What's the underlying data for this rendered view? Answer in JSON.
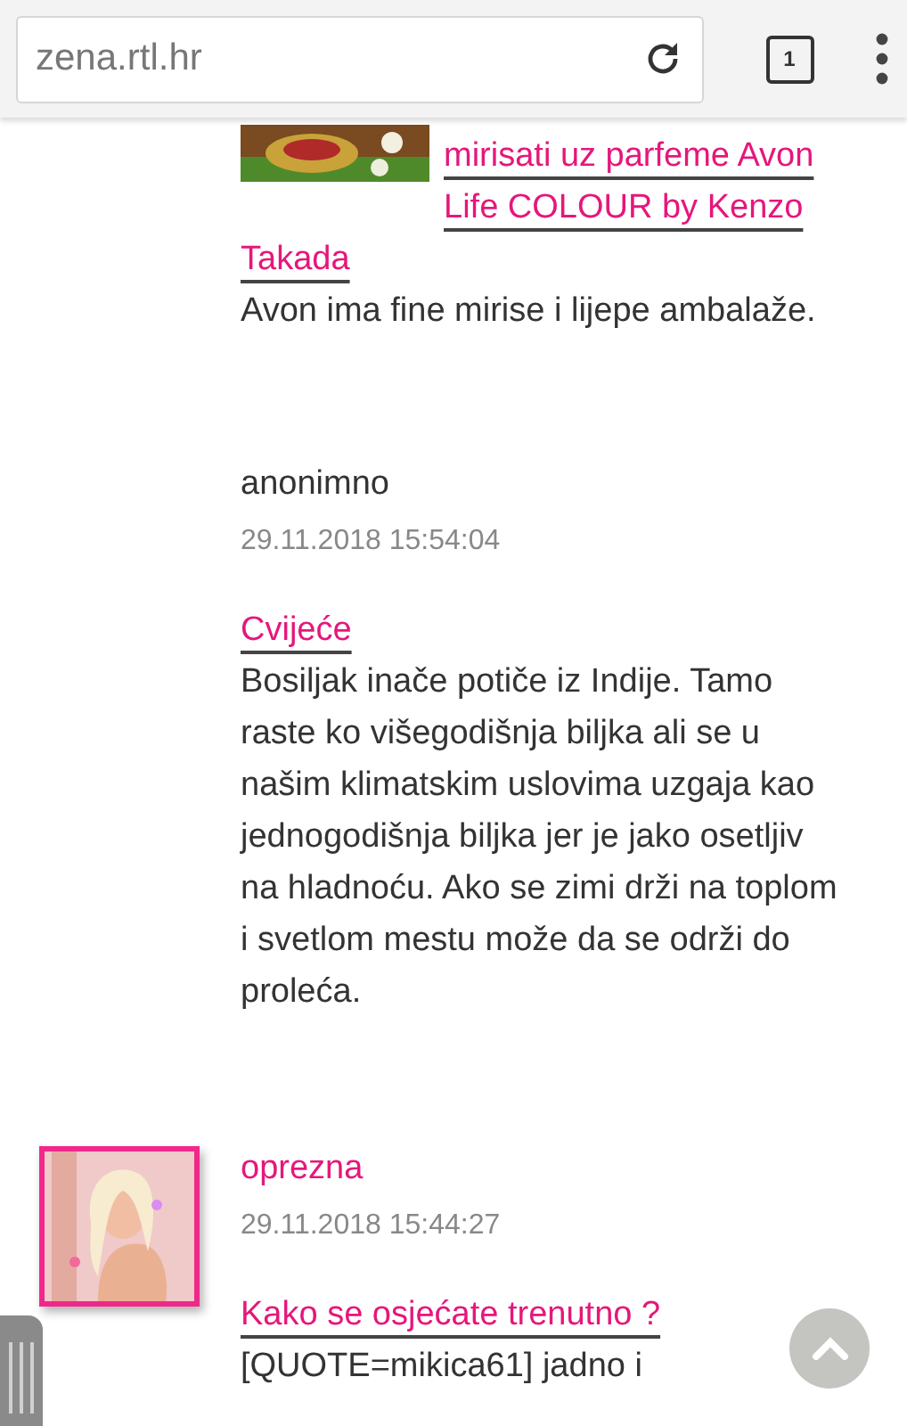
{
  "browser": {
    "url": "zena.rtl.hr",
    "tab_count": "1"
  },
  "posts": [
    {
      "kind": "article",
      "title_lines": [
        "mirisati uz parfeme Avon",
        "Life COLOUR by Kenzo",
        "Takada"
      ],
      "body": "Avon ima fine mirise i lijepe ambalaže."
    },
    {
      "kind": "comment",
      "author": "anonimno",
      "date": "29.11.2018 15:54:04",
      "topic": "Cvijeće",
      "body": "Bosiljak inače potiče iz Indije. Tamo raste ko višegodišnja biljka ali se u našim klimatskim uslovima uzgaja kao jednogodišnja biljka jer je jako osetljiv na hladnoću. Ako se zimi drži na toplom i svetlom mestu može da se održi do proleća."
    },
    {
      "kind": "comment",
      "author": "oprezna",
      "avatar": true,
      "date": "29.11.2018 15:44:27",
      "topic": "Kako se osjećate trenutno ?",
      "body": "[QUOTE=mikica61] jadno i"
    }
  ]
}
